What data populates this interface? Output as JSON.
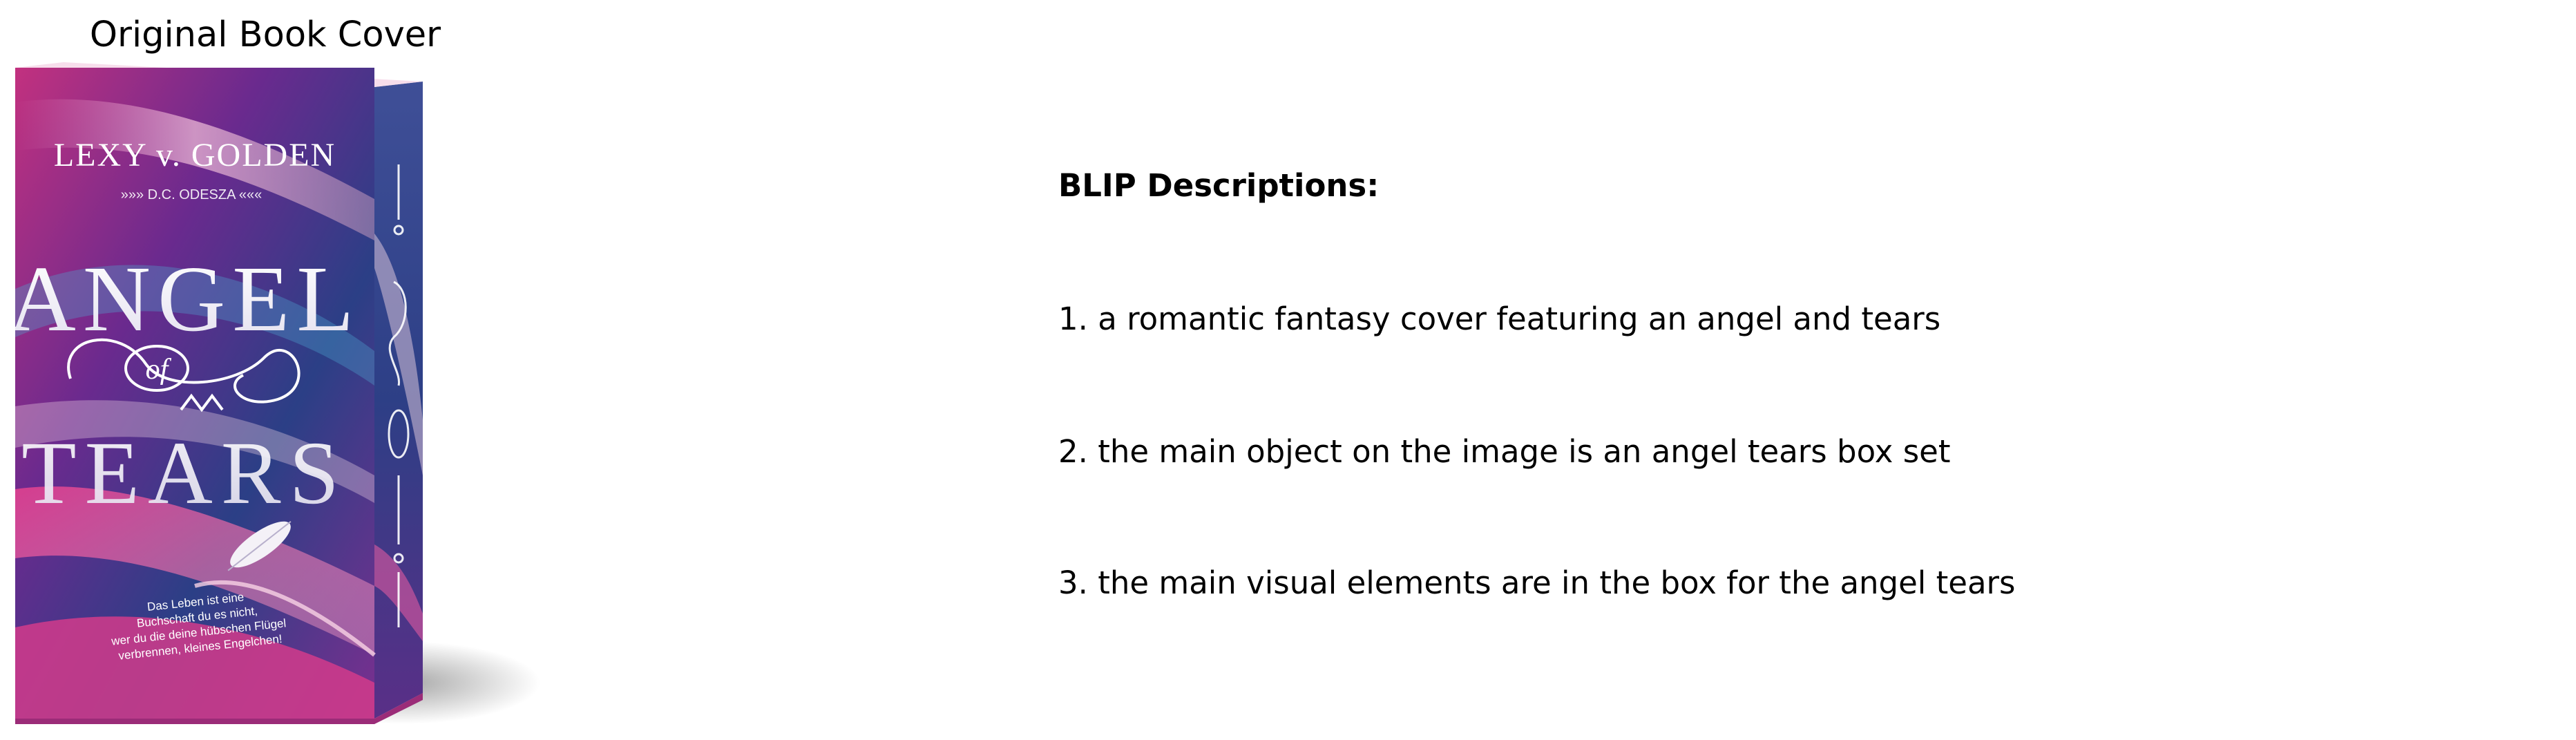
{
  "cover_panel": {
    "title": "Original Book Cover",
    "book": {
      "author": "LEXY v. GOLDEN",
      "subtitle_line": "»»» D.C. ODESZA «««",
      "title_line_1": "ANGEL",
      "title_ligature": "of",
      "title_line_2": "TEARS",
      "blurb": [
        "Das Leben ist eine",
        "Buchschaft du es nicht,",
        "wer du die deine hübschen Flügel",
        "verbrennen, kleines Engelchen!"
      ]
    }
  },
  "descriptions_panel": {
    "heading": "BLIP Descriptions:",
    "items": [
      "1. a romantic fantasy cover featuring an angel and tears",
      "2. the main object on the image is an angel tears box set",
      "3. the main visual elements are in the box for the angel tears"
    ]
  }
}
